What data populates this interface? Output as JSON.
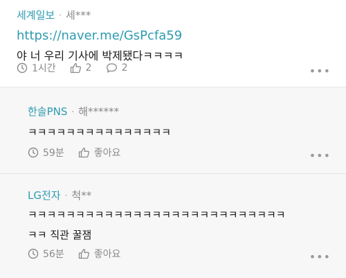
{
  "post": {
    "company": "세계일보",
    "user": "세***",
    "link": "https://naver.me/GsPcfa59",
    "text": "야 너 우리 기사에 박제됐다ㅋㅋㅋㅋ",
    "time": "1시간",
    "likes": "2",
    "comments": "2"
  },
  "replies": [
    {
      "company": "한솔PNS",
      "user": "해******",
      "text": "ㅋㅋㅋㅋㅋㅋㅋㅋㅋㅋㅋㅋㅋㅋㅋ",
      "time": "59분",
      "like_label": "좋아요"
    },
    {
      "company": "LG전자",
      "user": "척**",
      "text_line1": "ㅋㅋㅋㅋㅋㅋㅋㅋㅋㅋㅋㅋㅋㅋㅋㅋㅋㅋㅋㅋㅋㅋㅋㅋㅋㅋㅋ",
      "text_line2": "ㅋㅋ 직관 꿀잼",
      "time": "56분",
      "like_label": "좋아요"
    }
  ],
  "separator": "·",
  "more_label": "•••",
  "colors": {
    "accent": "#2e9bb0",
    "meta": "#8a8a8a",
    "reply_bg": "#f7f7f7"
  }
}
